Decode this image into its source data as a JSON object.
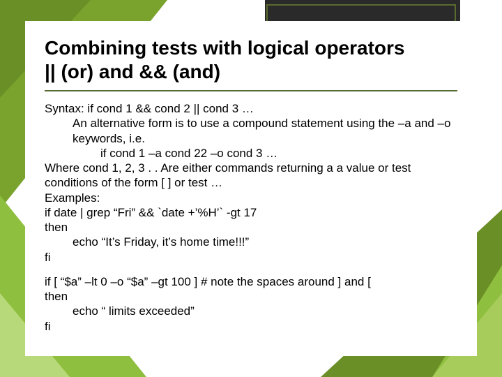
{
  "title_line1": "Combining tests with logical operators",
  "title_line2": "|| (or) and && (and)",
  "lines": {
    "l1": "Syntax: if  cond 1  && cond 2  ||  cond 3 …",
    "l2": "An alternative form is to use a compound statement using the –a and –o keywords, i.e.",
    "l3": "if cond 1 –a cond 22 –o cond 3 …",
    "l4": "Where cond 1, 2, 3 . . Are either commands returning a a value or test conditions of the form [  ]  or test …",
    "l5": "Examples:",
    "l6": "if  date | grep “Fri”  &&  `date +’%H’` -gt 17",
    "l7": "then",
    "l8": "echo “It’s Friday, it’s home time!!!”",
    "l9": "fi",
    "l10": "if [ “$a” –lt 0 –o “$a” –gt 100 ]      # note the spaces around ] and [",
    "l11": "then",
    "l12": "echo “ limits exceeded”",
    "l13": "fi"
  }
}
